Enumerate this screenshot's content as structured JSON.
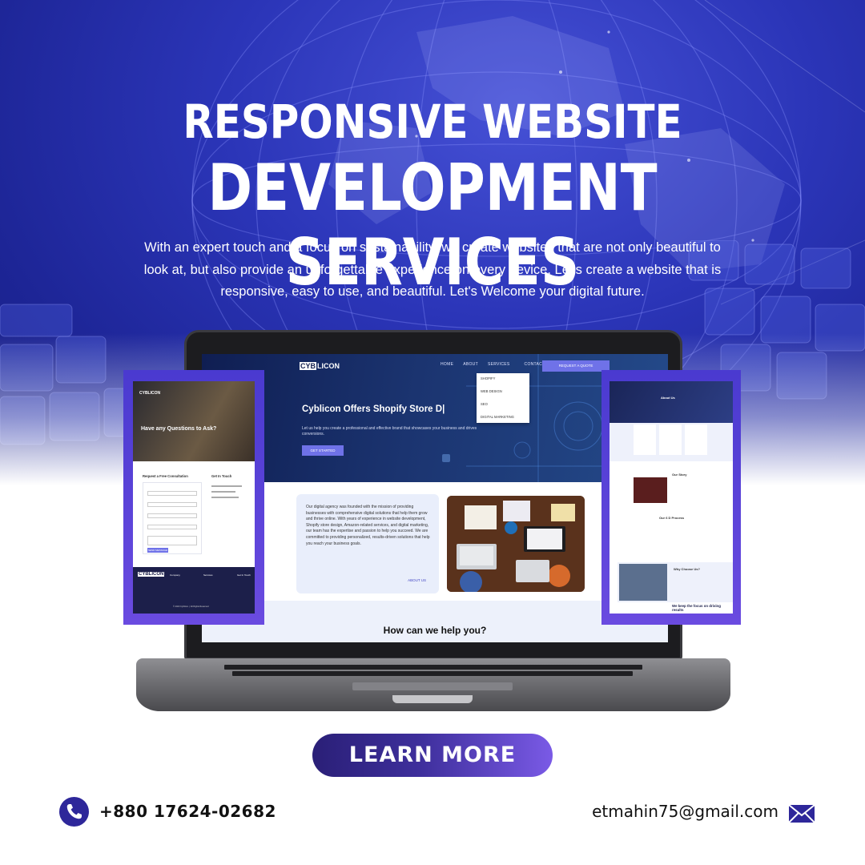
{
  "headline": {
    "line1": "RESPONSIVE WEBSITE",
    "line2": "DEVELOPMENT SERVICES"
  },
  "subtitle": "With an expert touch and a focus on sustainability, we create websites that are not only beautiful to look at, but also provide an unforgettable experience on every device. Let's create a website that is responsive, easy to use, and beautiful. Let's Welcome your digital future.",
  "laptop_site": {
    "logo_prefix": "CYB",
    "logo_suffix": "LICON",
    "nav": [
      "HOME",
      "ABOUT",
      "SERVICES",
      "CONTACT"
    ],
    "quote_button": "REQUEST A QUOTE",
    "dropdown": [
      "SHOPIFY",
      "WEB DESIGN",
      "SEO",
      "DIGITAL MARKETING"
    ],
    "hero_heading": "Cyblicon Offers Shopify Store D|",
    "hero_text": "Let us help you create a professional and effective brand that showcases your business and drives conversions.",
    "get_started": "GET STARTED",
    "about_text": "Our digital agency was founded with the mission of providing businesses with comprehensive digital solutions that help them grow and thrive online. With years of experience in website development, Shopify store design, Amazon-related services, and digital marketing, our team has the expertise and passion to help you succeed. We are committed to providing personalized, results-driven solutions that help you reach your business goals.",
    "about_link": "ABOUT US",
    "help_heading": "How can we help you?"
  },
  "phone_left": {
    "logo": "CYBLICON",
    "banner_heading": "Have any Questions to Ask?",
    "form_title": "Request a Free Consultation",
    "contact_title": "Get In Touch",
    "submit": "SEND MESSAGE",
    "footer_logo": "CYBLICON",
    "footer_cols": [
      "Company",
      "Services",
      "Get In Touch"
    ],
    "copyright": "© 2023 Cyblicon. | All Rights Reserved"
  },
  "phone_right": {
    "about_heading": "About Us",
    "story_heading": "Our Story",
    "process_heading": "Our 6 D Process",
    "why_heading": "Why Choose Us?",
    "focus_heading": "We keep the focus on driving results"
  },
  "cta": {
    "label": "LEARN MORE"
  },
  "contact": {
    "phone": "+880 17624-02682",
    "email": "etmahin75@gmail.com"
  },
  "colors": {
    "hero_blue": "#2b35b8",
    "accent_purple": "#6f72e8",
    "cta_dark": "#2a1f77",
    "cta_light": "#7a5ae6"
  }
}
